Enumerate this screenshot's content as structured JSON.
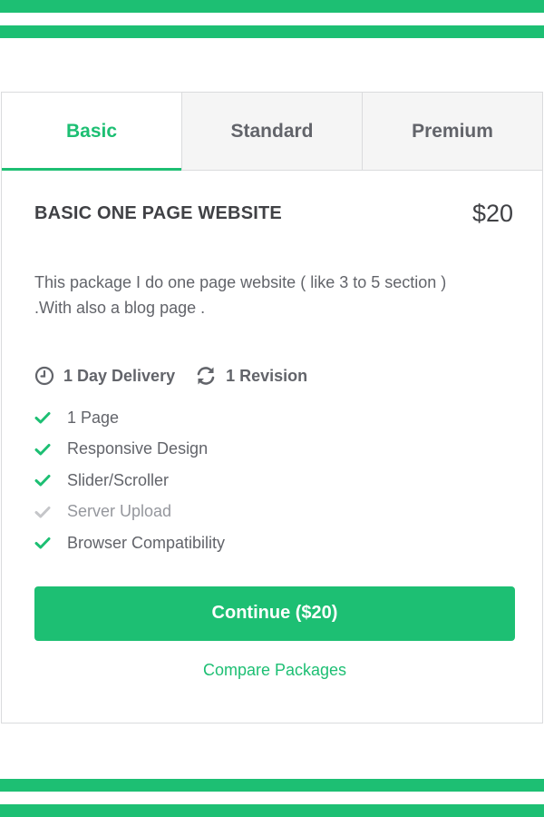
{
  "colors": {
    "accent": "#1dbf73",
    "text": "#404145",
    "muted": "#62646a",
    "disabled": "#c5c6c9"
  },
  "tabs": [
    {
      "label": "Basic",
      "active": true
    },
    {
      "label": "Standard",
      "active": false
    },
    {
      "label": "Premium",
      "active": false
    }
  ],
  "package": {
    "title": "BASIC ONE PAGE WEBSITE",
    "price": "$20",
    "description": "This package I do one page website ( like 3 to 5 section ) .With also a blog page .",
    "delivery": {
      "icon": "clock-icon",
      "label": "1 Day Delivery"
    },
    "revisions": {
      "icon": "refresh-icon",
      "label": "1 Revision"
    },
    "features": [
      {
        "label": "1 Page",
        "included": true
      },
      {
        "label": "Responsive Design",
        "included": true
      },
      {
        "label": "Slider/Scroller",
        "included": true
      },
      {
        "label": "Server Upload",
        "included": false
      },
      {
        "label": "Browser Compatibility",
        "included": true
      }
    ]
  },
  "cta": {
    "continue_label": "Continue ($20)",
    "compare_label": "Compare Packages"
  }
}
